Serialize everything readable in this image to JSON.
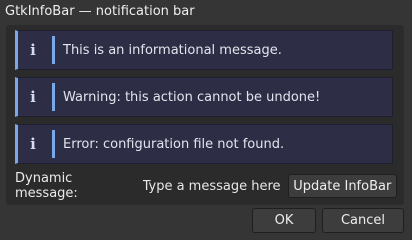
{
  "window": {
    "title": "GtkInfoBar — notification bar"
  },
  "infobars": [
    {
      "icon": "info-icon",
      "glyph": "i",
      "message": "This is an informational message."
    },
    {
      "icon": "info-icon",
      "glyph": "i",
      "message": "Warning: this action cannot be undone!"
    },
    {
      "icon": "info-icon",
      "glyph": "i",
      "message": "Error: configuration file not found."
    }
  ],
  "dynamic": {
    "label": "Dynamic message:",
    "placeholder": "Type a message here",
    "value": "",
    "button": "Update InfoBar"
  },
  "dialog": {
    "ok_label": "OK",
    "cancel_label": "Cancel"
  },
  "colors": {
    "accent": "#7aa7e8",
    "infobar_bg": "#2d2d45",
    "window_bg": "#353535"
  }
}
